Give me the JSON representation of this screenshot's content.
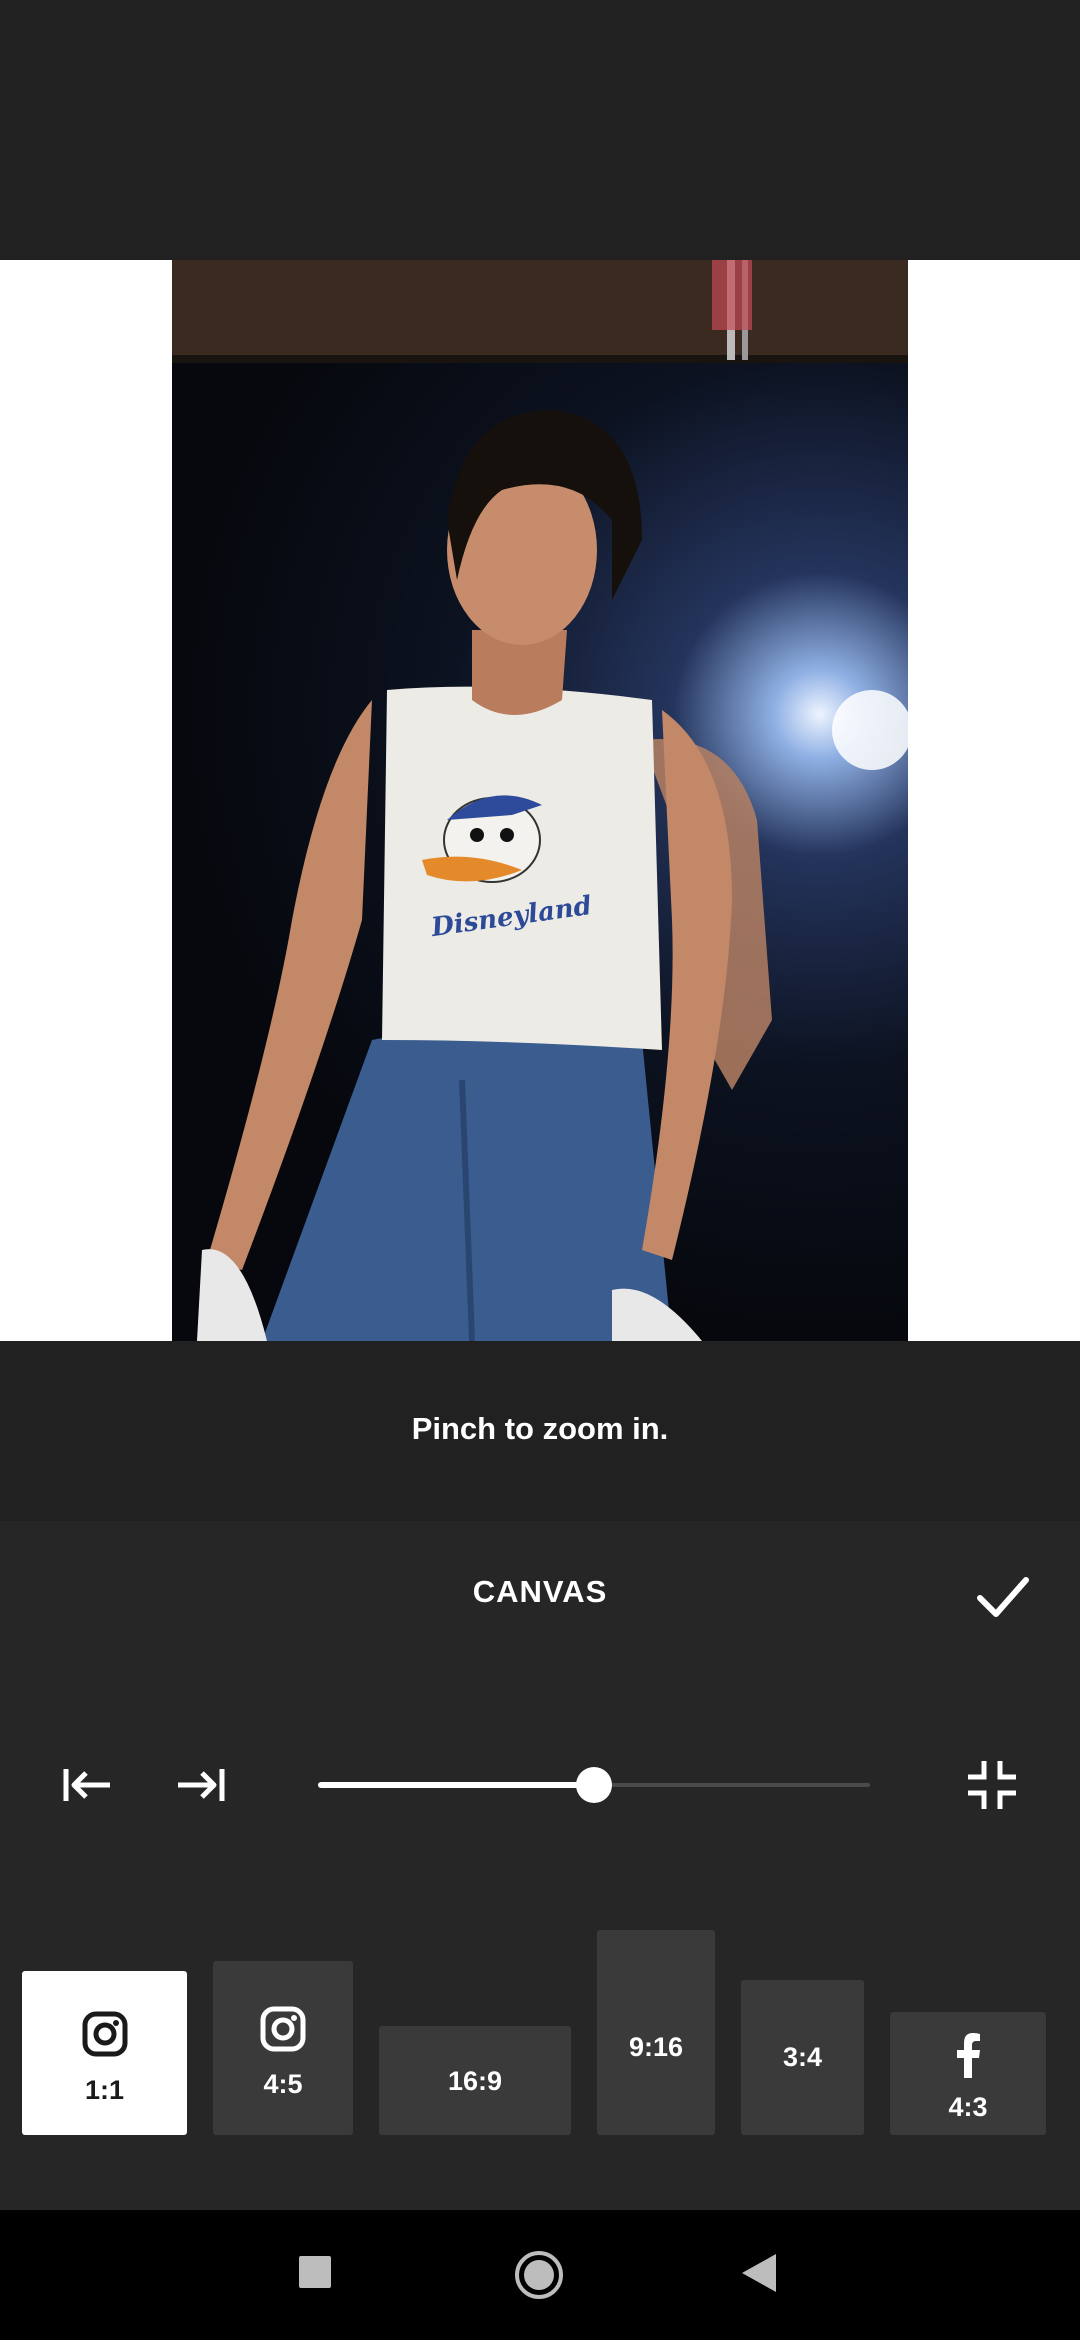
{
  "hint": {
    "text": "Pinch to zoom in."
  },
  "panel": {
    "title": "CANVAS",
    "confirm_icon": "check-icon",
    "controls": {
      "align_left_icon": "align-left-icon",
      "align_right_icon": "align-right-icon",
      "collapse_icon": "collapse-icon"
    },
    "slider": {
      "value": 0.5
    }
  },
  "photo": {
    "shirt_print": "Disneyland"
  },
  "ratios": [
    {
      "label": "1:1",
      "icon": "instagram-icon",
      "selected": true
    },
    {
      "label": "4:5",
      "icon": "instagram-icon",
      "selected": false
    },
    {
      "label": "16:9",
      "icon": "",
      "selected": false
    },
    {
      "label": "9:16",
      "icon": "",
      "selected": false
    },
    {
      "label": "3:4",
      "icon": "",
      "selected": false
    },
    {
      "label": "4:3",
      "icon": "facebook-icon",
      "selected": false
    }
  ],
  "nav": {
    "recents_icon": "recents-square-icon",
    "home_icon": "home-circle-icon",
    "back_icon": "back-triangle-icon"
  },
  "colors": {
    "accent": "#ffffff",
    "background": "#212121",
    "panel": "#262626",
    "chip": "#3a3a3a"
  }
}
